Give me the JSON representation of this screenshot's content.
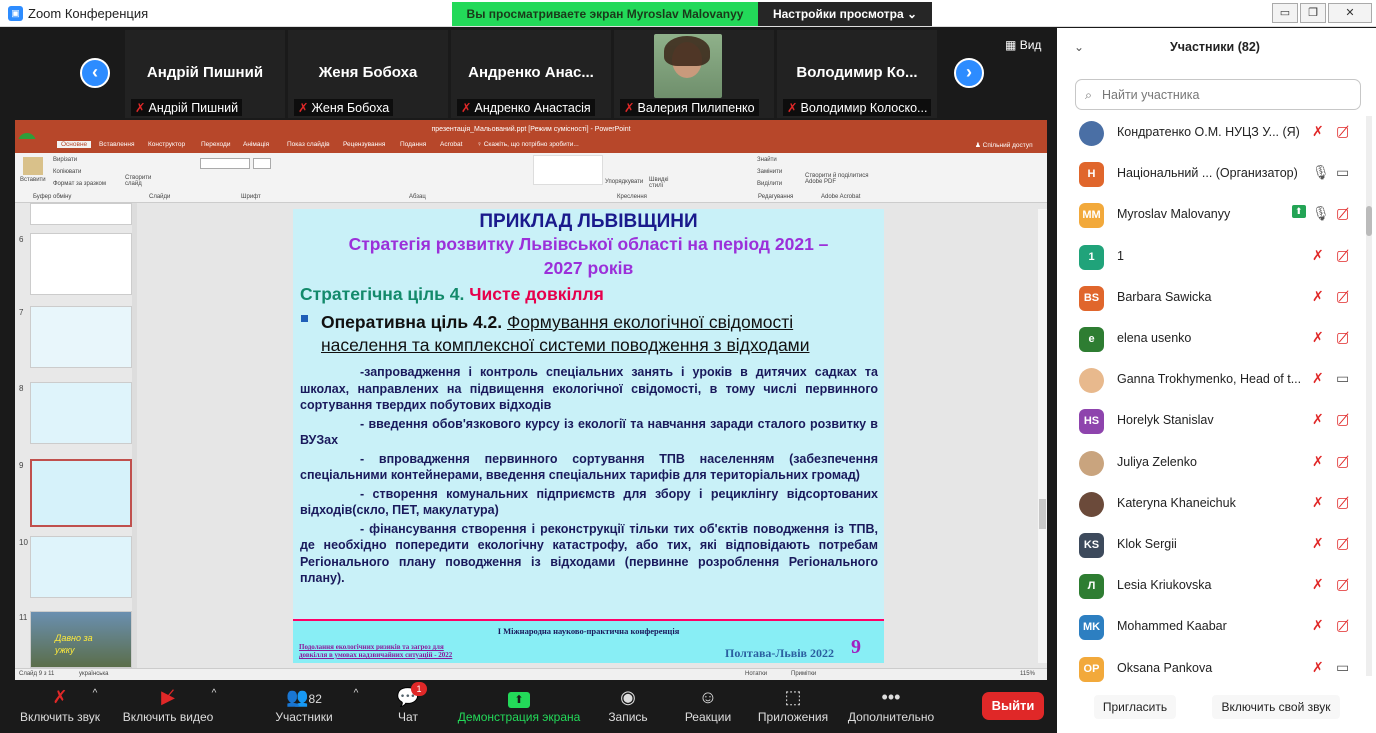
{
  "window": {
    "app_title": "Zoom Конференция",
    "share_banner": "Вы просматриваете экран Myroslav Malovanyy",
    "view_options": "Настройки просмотра"
  },
  "strip": {
    "view_label": "Вид",
    "tiles": [
      {
        "name": "Андрій Пишний",
        "label": "Андрій Пишний"
      },
      {
        "name": "Женя Бобоха",
        "label": "Женя Бобоха"
      },
      {
        "name": "Андренко  Анас...",
        "label": "Андренко Анастасія"
      },
      {
        "name": "",
        "label": "Валерия Пилипенко"
      },
      {
        "name": "Володимир  Ко...",
        "label": "Володимир Колоско..."
      }
    ]
  },
  "ppt": {
    "window_title": "презентація_Мальований.ppt [Режим сумісності] - PowerPoint",
    "tabs": [
      "Основне",
      "Вставлення",
      "Конструктор",
      "Переходи",
      "Анімація",
      "Показ слайдів",
      "Рецензування",
      "Подання",
      "Acrobat"
    ],
    "search_hint": "Скажіть, що потрібно зробити...",
    "share_label": "Спільний доступ",
    "ribbon_groups": [
      "Буфер обміну",
      "Слайди",
      "Шрифт",
      "Абзац",
      "Креслення",
      "Редагування",
      "Adobe Acrobat"
    ],
    "ribbon_items": {
      "paste": "Вставити",
      "cut": "Вирізати",
      "copy": "Копіювати",
      "format": "Формат за зразком",
      "new_slide": "Створити слайд",
      "find": "Знайти",
      "replace": "Замінити",
      "select": "Виділити",
      "arrange": "Упорядкувати",
      "styles": "Швидкі стилі",
      "create_pdf": "Створити й поділитися Adobe PDF"
    },
    "status": {
      "slide": "Слайд 9 з 11",
      "lang": "українська",
      "notes": "Нотатки",
      "comments": "Примітки",
      "zoom": "115%"
    },
    "thumb_numbers": [
      "6",
      "7",
      "8",
      "9",
      "10",
      "11"
    ],
    "thumb11_text": "Давно за ужкy"
  },
  "slide": {
    "title": "ПРИКЛАД ЛЬВІВЩИНИ",
    "subtitle1": "Стратегія розвитку Львівської області на період 2021 –",
    "subtitle2": "2027 років",
    "goal_prefix": "Стратегічна ціль 4.",
    "goal_suffix": " Чисте довкілля",
    "op_prefix": "Оперативна ціль 4.2.",
    "op_line1": "Формування екологічної свідомості",
    "op_line2": "населення та комплексної системи поводження з відходами",
    "bullets": [
      "-запровадження і контроль спеціальних занять і уроків в дитячих садках та школах, направлених на підвищення екологічної свідомості, в тому числі первинного сортування твердих побутових відходів",
      "- введення обов'язкового курсу із екології та навчання заради сталого розвитку в ВУЗах",
      "- впровадження первинного сортування ТПВ населенням (забезпечення спеціальними контейнерами, введення спеціальних тарифів для територіальних громад)",
      "- створення комунальних підприємств для збору і рециклінгу відсортованих відходів(скло, ПЕТ, макулатура)",
      "- фінансування створення і реконструкції тільки тих об'єктів поводження із ТПВ, де необхідно попередити екологічну катастрофу, або тих, які відповідають потребам Регіонального плану поводження із відходами (первинне розроблення Регіонального плану)."
    ],
    "footer_conf": "І Міжнародна науково-практична конференція",
    "footer_left1": "Подолання екологічних ризиків та загроз для",
    "footer_left2": "довкілля в умовах надзвичайних ситуацій - 2022",
    "footer_right": "Полтава-Львів 2022",
    "slide_number": "9"
  },
  "toolbar": {
    "mute": "Включить звук",
    "video": "Включить видео",
    "participants": "Участники",
    "participants_count": "82",
    "chat": "Чат",
    "chat_badge": "1",
    "share": "Демонстрация экрана",
    "record": "Запись",
    "reactions": "Реакции",
    "apps": "Приложения",
    "more": "Дополнительно",
    "leave": "Выйти"
  },
  "panel": {
    "title": "Участники (82)",
    "search_placeholder": "Найти участника",
    "participants": [
      {
        "initials": "",
        "name": "Кондратенко О.М. НУЦЗ У... (Я)",
        "color": "#4a6fa5",
        "photo": true
      },
      {
        "initials": "Н",
        "name": "Національний ... (Организатор)",
        "color": "#e0662c"
      },
      {
        "initials": "MM",
        "name": "Myroslav Malovanyy",
        "color": "#f2a93b"
      },
      {
        "initials": "1",
        "name": "1",
        "color": "#20a37a"
      },
      {
        "initials": "BS",
        "name": "Barbara Sawicka",
        "color": "#e0662c"
      },
      {
        "initials": "e",
        "name": "elena usenko",
        "color": "#2e7d32"
      },
      {
        "initials": "",
        "name": "Ganna Trokhymenko, Head of t...",
        "color": "#e8b98d",
        "photo": true
      },
      {
        "initials": "HS",
        "name": "Horelyk Stanislav",
        "color": "#8e44ad"
      },
      {
        "initials": "",
        "name": "Juliya Zelenko",
        "color": "#c9a47e",
        "photo": true
      },
      {
        "initials": "",
        "name": "Kateryna Khaneichuk",
        "color": "#6b4a3a",
        "photo": true
      },
      {
        "initials": "KS",
        "name": "Klok Sergii",
        "color": "#3d4a5c"
      },
      {
        "initials": "Л",
        "name": "Lesia Kriukovska",
        "color": "#2e7d32"
      },
      {
        "initials": "MK",
        "name": "Mohammed Kaabar",
        "color": "#2d7fc1"
      },
      {
        "initials": "OP",
        "name": "Oksana Pankova",
        "color": "#f2a93b"
      }
    ],
    "invite": "Пригласить",
    "unmute_me": "Включить свой звук"
  }
}
